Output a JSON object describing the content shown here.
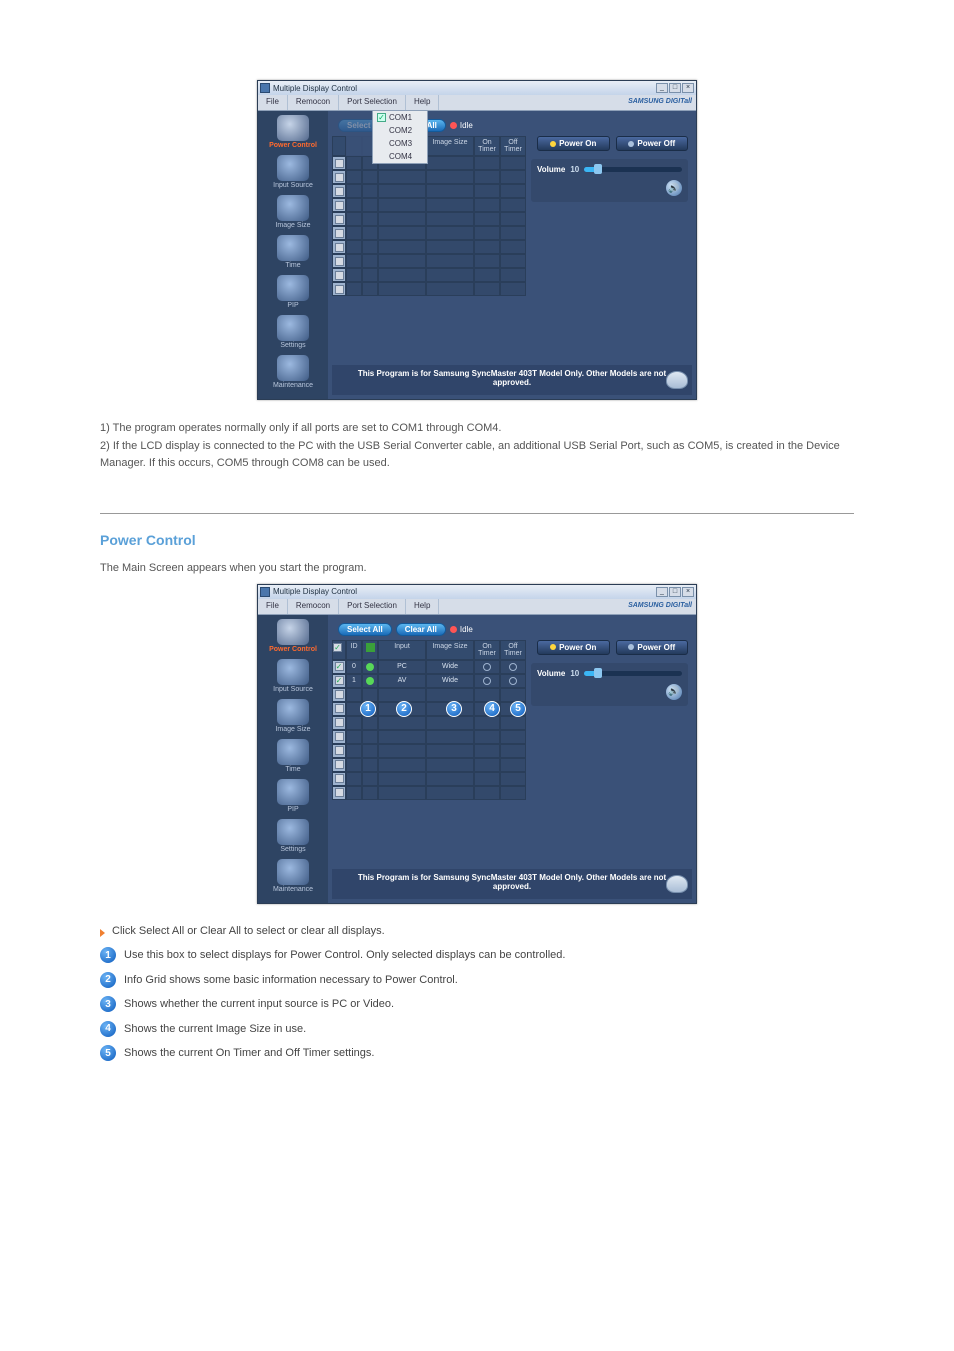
{
  "app_title": "Multiple Display Control",
  "brand": "SAMSUNG DIGITall",
  "menubar": [
    "File",
    "Remocon",
    "Port Selection",
    "Help"
  ],
  "com_items": [
    "COM1",
    "COM2",
    "COM3",
    "COM4"
  ],
  "sidebar": [
    {
      "label": "Power Control"
    },
    {
      "label": "Input Source"
    },
    {
      "label": "Image Size"
    },
    {
      "label": "Time"
    },
    {
      "label": "PIP"
    },
    {
      "label": "Settings"
    },
    {
      "label": "Maintenance"
    }
  ],
  "buttons": {
    "select_all": "Select All",
    "clear_all": "Clear All",
    "idle": "Idle",
    "power_on": "Power On",
    "power_off": "Power Off"
  },
  "columns": {
    "chk": "",
    "id": "ID",
    "status": "",
    "input": "Input",
    "size": "Image Size",
    "on": "On Timer",
    "off": "Off Timer"
  },
  "rows": [
    {
      "id": "0",
      "status": "on",
      "input": "PC",
      "size": "Wide",
      "on": "o",
      "off": "o"
    },
    {
      "id": "1",
      "status": "on",
      "input": "AV",
      "size": "Wide",
      "on": "o",
      "off": "o"
    }
  ],
  "volume": {
    "label": "Volume",
    "value": "10"
  },
  "footer_msg": "This Program is for Samsung SyncMaster 403T Model Only. Other Models are not approved.",
  "captions": {
    "c1l1": "1) The program operates normally only if all ports are set to COM1 through COM4.",
    "c1l2": "2) If the LCD display is connected to the PC with the USB Serial Converter cable, an additional USB Serial Port, such as COM5, is created in the Device Manager. If this occurs, COM5 through COM8 can be used."
  },
  "section2_title": "Power Control",
  "section2_sub": "The Main Screen appears when you start the program.",
  "grid_desc": "Click Select All or Clear All to select or clear all displays.",
  "numbadges": [
    "1",
    "2",
    "3",
    "4",
    "5"
  ],
  "numlist": [
    "Use this box to select displays for Power Control. Only selected displays can be controlled.",
    "Info Grid shows some basic information necessary to Power Control.",
    "Shows whether the current input source is PC or Video.",
    "Shows the current Image Size in use.",
    "Shows the current On Timer and Off Timer settings."
  ]
}
